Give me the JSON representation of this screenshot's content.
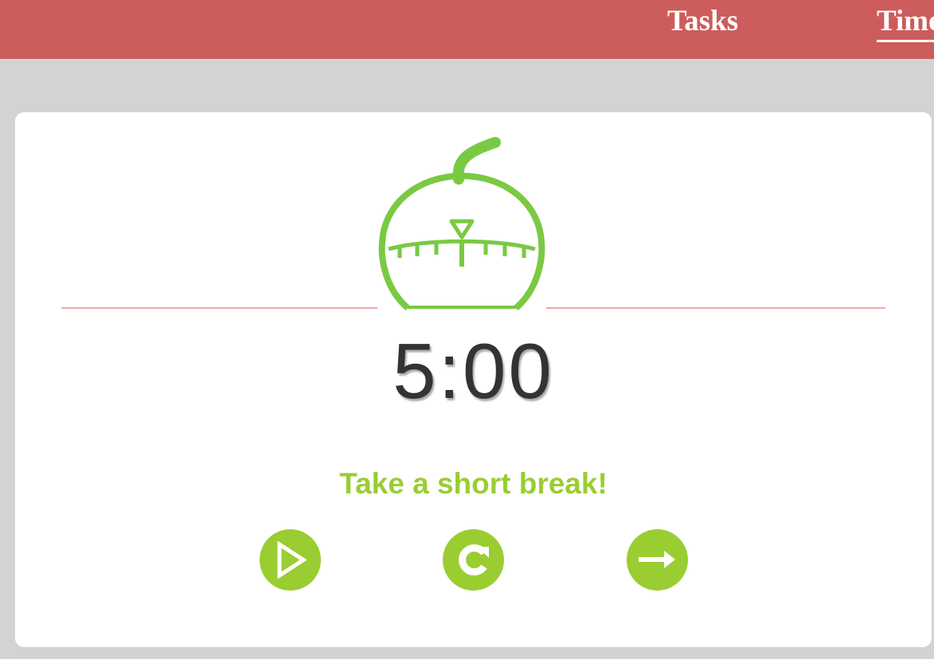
{
  "nav": {
    "tasks_label": "Tasks",
    "timer_label": "Timer"
  },
  "timer": {
    "logo_icon": "pomodoro-timer-icon",
    "time": "5:00",
    "message": "Take a short break!"
  },
  "controls": [
    {
      "icon": "play-icon"
    },
    {
      "icon": "reset-icon"
    },
    {
      "icon": "skip-arrow-icon"
    }
  ],
  "colors": {
    "navbar": "#cd5c5c",
    "accent_green": "#9acd32",
    "logo_green": "#7ac943",
    "divider": "#f0a8a8",
    "background": "#d3d3d3",
    "time_text": "#333333"
  }
}
